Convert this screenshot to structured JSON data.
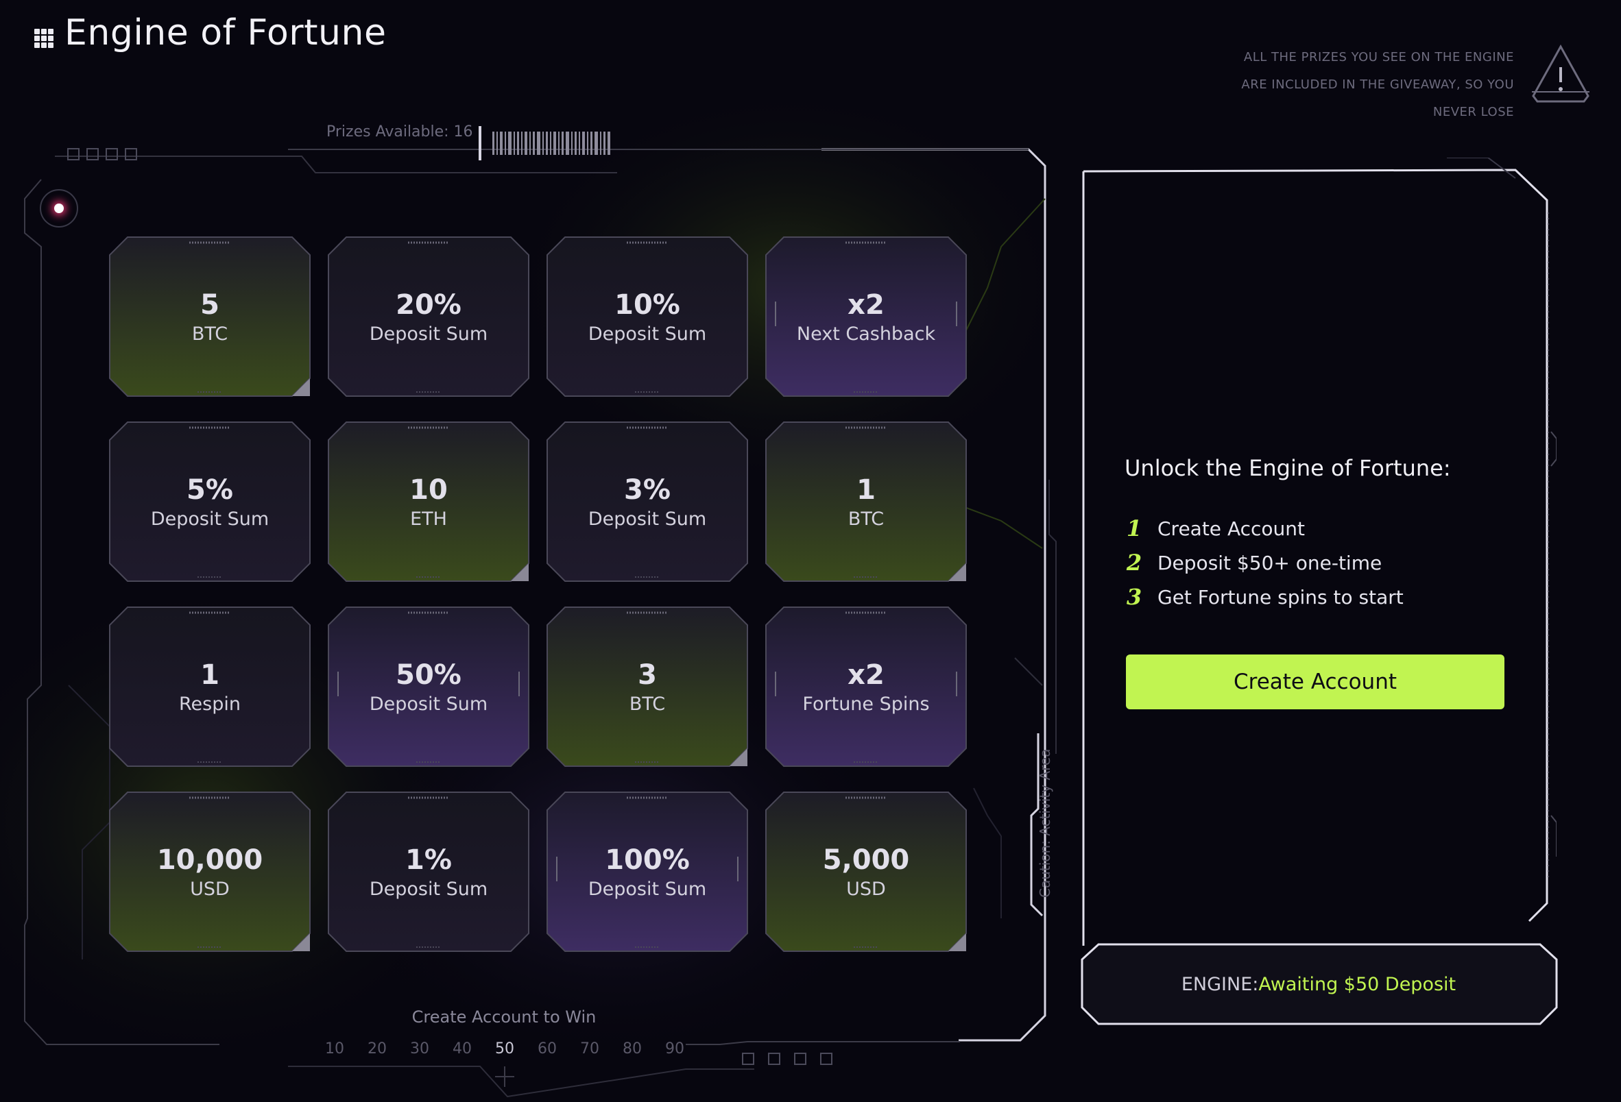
{
  "app": {
    "title": "Engine of Fortune"
  },
  "notice": {
    "lines": [
      "ALL THE PRIZES YOU SEE ON THE ENGINE",
      "ARE INCLUDED IN THE GIVEAWAY, SO YOU",
      "NEVER LOSE"
    ]
  },
  "board": {
    "prizes_available": "Prizes Available: 16",
    "caution": "Caution: Activity Area",
    "footer": "Create Account to Win",
    "scale": [
      "10",
      "20",
      "30",
      "40",
      "50",
      "60",
      "70",
      "80",
      "90"
    ],
    "scale_active": "50"
  },
  "tiles": [
    {
      "value": "5",
      "label": "BTC",
      "tone": "green"
    },
    {
      "value": "20%",
      "label": "Deposit Sum",
      "tone": "dark"
    },
    {
      "value": "10%",
      "label": "Deposit Sum",
      "tone": "dark"
    },
    {
      "value": "x2",
      "label": "Next Cashback",
      "tone": "purple"
    },
    {
      "value": "5%",
      "label": "Deposit Sum",
      "tone": "dark"
    },
    {
      "value": "10",
      "label": "ETH",
      "tone": "green"
    },
    {
      "value": "3%",
      "label": "Deposit Sum",
      "tone": "dark"
    },
    {
      "value": "1",
      "label": "BTC",
      "tone": "green"
    },
    {
      "value": "1",
      "label": "Respin",
      "tone": "dark"
    },
    {
      "value": "50%",
      "label": "Deposit Sum",
      "tone": "purple"
    },
    {
      "value": "3",
      "label": "BTC",
      "tone": "green"
    },
    {
      "value": "x2",
      "label": "Fortune Spins",
      "tone": "purple"
    },
    {
      "value": "10,000",
      "label": "USD",
      "tone": "green"
    },
    {
      "value": "1%",
      "label": "Deposit Sum",
      "tone": "dark"
    },
    {
      "value": "100%",
      "label": "Deposit Sum",
      "tone": "purple"
    },
    {
      "value": "5,000",
      "label": "USD",
      "tone": "green"
    }
  ],
  "panel": {
    "title": "Unlock the Engine of Fortune:",
    "steps": [
      {
        "num": "1",
        "text": "Create Account"
      },
      {
        "num": "2",
        "text": "Deposit $50+ one-time"
      },
      {
        "num": "3",
        "text": "Get Fortune spins to start"
      }
    ],
    "button": "Create Account",
    "status_key": "ENGINE:",
    "status_value": "Awaiting $50 Deposit"
  },
  "colors": {
    "accent": "#c1f451",
    "background": "#07060f",
    "tile_green": "#3a4a1c",
    "tile_purple": "#3e2d62"
  },
  "icons": {
    "menu": "grid-menu-icon",
    "warning": "warning-triangle-icon"
  }
}
